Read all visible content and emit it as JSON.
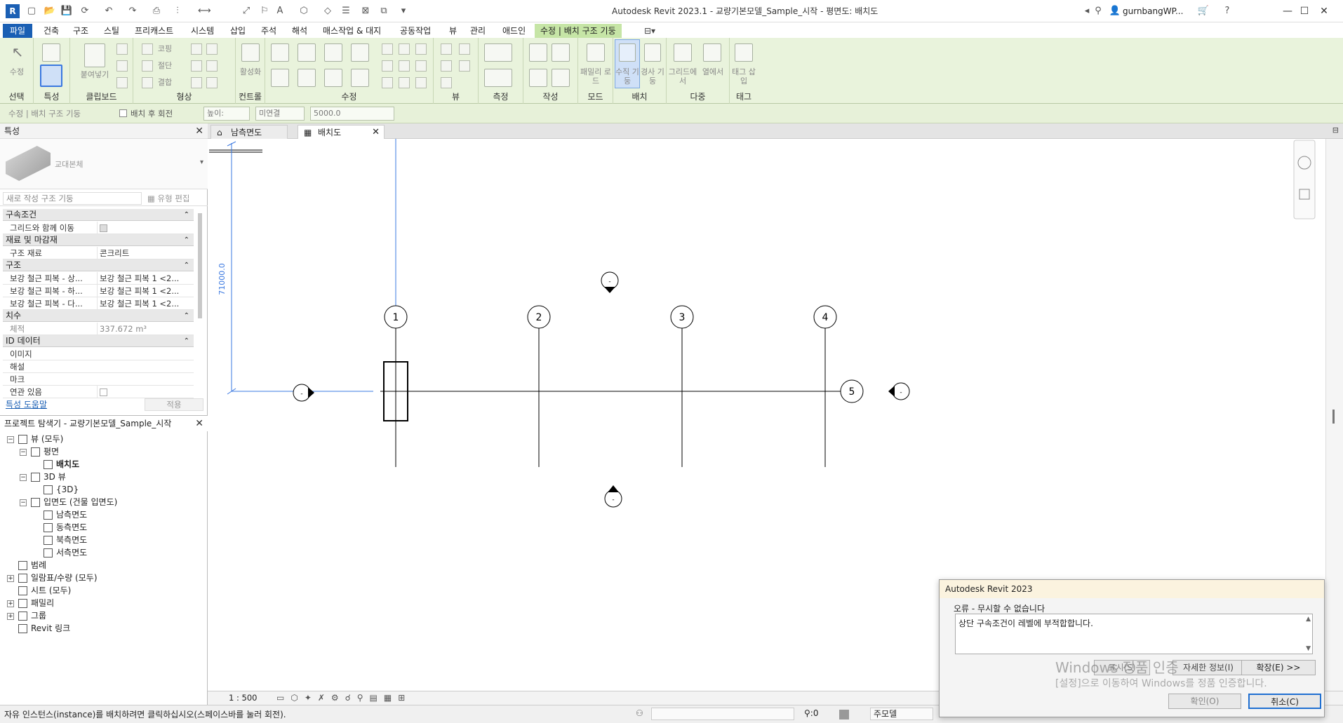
{
  "titlebar": {
    "app_title": "Autodesk Revit 2023.1 - 교량기본모델_Sample_시작 - 평면도: 배치도",
    "logo": "R",
    "user": "gurnbangWP...",
    "icons": [
      "open-icon",
      "save-icon",
      "sync-icon",
      "undo-icon",
      "redo-icon",
      "print-icon",
      "measure-icon",
      "text-icon",
      "3d-icon",
      "section-icon",
      "close-hidden-icon"
    ]
  },
  "ribbon_tabs": [
    "파일",
    "건축",
    "구조",
    "스틸",
    "프리캐스트",
    "시스템",
    "삽입",
    "주석",
    "해석",
    "매스작업 & 대지",
    "공동작업",
    "뷰",
    "관리",
    "애드인",
    "수정 | 배치 구조 기둥"
  ],
  "ribbon": {
    "groups": [
      {
        "label": "선택",
        "buttons": [
          "수정"
        ]
      },
      {
        "label": "특성",
        "buttons": []
      },
      {
        "label": "클립보드",
        "buttons": [
          "붙여넣기"
        ]
      },
      {
        "label": "형상",
        "buttons": [
          "코핑",
          "절단",
          "결합"
        ]
      },
      {
        "label": "컨트롤",
        "buttons": [
          "활성화"
        ]
      },
      {
        "label": "수정",
        "buttons": []
      },
      {
        "label": "뷰",
        "buttons": []
      },
      {
        "label": "측정",
        "buttons": []
      },
      {
        "label": "작성",
        "buttons": []
      },
      {
        "label": "모드",
        "buttons": [
          "패밀리 로드"
        ]
      },
      {
        "label": "배치",
        "buttons": [
          "수직 기둥",
          "경사 기둥"
        ]
      },
      {
        "label": "다중",
        "buttons": [
          "그리드에서",
          "열에서"
        ]
      },
      {
        "label": "태그",
        "buttons": [
          "태그 삽입"
        ]
      }
    ]
  },
  "optionsbar": {
    "context": "수정 | 배치 구조 기둥",
    "rotate_after": "배치 후 회전",
    "height_mode": "높이:",
    "connect": "미연결",
    "value": "5000.0"
  },
  "properties": {
    "title": "특성",
    "type_name": "교대본체",
    "instance_filter": "새로 작성 구조 기둥",
    "edit_type": "유형 편집",
    "sections": [
      {
        "name": "구속조건",
        "rows": [
          {
            "k": "그리드와 함께 이동",
            "v": ""
          }
        ]
      },
      {
        "name": "재료 및 마감재",
        "rows": [
          {
            "k": "구조 재료",
            "v": "콘크리트"
          }
        ]
      },
      {
        "name": "구조",
        "rows": [
          {
            "k": "보강 철근 피복 - 상...",
            "v": "보강 철근 피복 1 <2..."
          },
          {
            "k": "보강 철근 피복 - 하...",
            "v": "보강 철근 피복 1 <2..."
          },
          {
            "k": "보강 철근 피복 - 다...",
            "v": "보강 철근 피복 1 <2..."
          }
        ]
      },
      {
        "name": "치수",
        "rows": [
          {
            "k": "체적",
            "v": "337.672 m³"
          }
        ]
      },
      {
        "name": "ID 데이터",
        "rows": [
          {
            "k": "이미지",
            "v": ""
          },
          {
            "k": "해설",
            "v": ""
          },
          {
            "k": "마크",
            "v": ""
          },
          {
            "k": "연관 있음",
            "v": ""
          }
        ]
      }
    ],
    "help_link": "특성 도움말",
    "apply": "적용"
  },
  "browser": {
    "title": "프로젝트 탐색기 - 교량기본모델_Sample_시작",
    "items": [
      {
        "label": "뷰 (모두)",
        "level": 0,
        "exp": "−"
      },
      {
        "label": "평면",
        "level": 1,
        "exp": "−"
      },
      {
        "label": "배치도",
        "level": 2,
        "exp": "",
        "bold": true
      },
      {
        "label": "3D 뷰",
        "level": 1,
        "exp": "−"
      },
      {
        "label": "{3D}",
        "level": 2,
        "exp": ""
      },
      {
        "label": "입면도 (건물 입면도)",
        "level": 1,
        "exp": "−"
      },
      {
        "label": "남측면도",
        "level": 2,
        "exp": ""
      },
      {
        "label": "동측면도",
        "level": 2,
        "exp": ""
      },
      {
        "label": "북측면도",
        "level": 2,
        "exp": ""
      },
      {
        "label": "서측면도",
        "level": 2,
        "exp": ""
      },
      {
        "label": "범례",
        "level": 0,
        "exp": ""
      },
      {
        "label": "일람표/수량 (모두)",
        "level": 0,
        "exp": "+"
      },
      {
        "label": "시트 (모두)",
        "level": 0,
        "exp": ""
      },
      {
        "label": "패밀리",
        "level": 0,
        "exp": "+"
      },
      {
        "label": "그룹",
        "level": 0,
        "exp": "+"
      },
      {
        "label": "Revit 링크",
        "level": 0,
        "exp": ""
      }
    ]
  },
  "view_tabs": [
    {
      "label": "남측면도",
      "active": false
    },
    {
      "label": "배치도",
      "active": true
    }
  ],
  "canvas": {
    "grid_labels": [
      "1",
      "2",
      "3",
      "4",
      "5"
    ],
    "dimension": "71000.0",
    "elevation_marker": "-"
  },
  "viewbar": {
    "scale": "1 : 500"
  },
  "statusbar": {
    "text": "자유 인스턴스(instance)를 배치하려면 클릭하십시오(스페이스바를 눌러 회전).",
    "count": ":0",
    "model": "주모델"
  },
  "dialog": {
    "title": "Autodesk Revit 2023",
    "heading": "오류 - 무시할 수 없습니다",
    "message": "상단 구속조건이 레벨에 부적합합니다.",
    "show_btn": "표시(S)",
    "more_info": "자세한 정보(I)",
    "expand": "확장(E) >>",
    "ok": "확인(O)",
    "cancel": "취소(C)"
  },
  "watermark": {
    "line1": "Windows 정품 인증",
    "line2": "[설정]으로 이동하여 Windows를 정품 인증합니다."
  },
  "colors": {
    "accent": "#1a5fb4",
    "ribbon_bg": "#e9f3dc",
    "selection_blue": "#3a78e0",
    "dialog_title": "#fbf3df"
  }
}
